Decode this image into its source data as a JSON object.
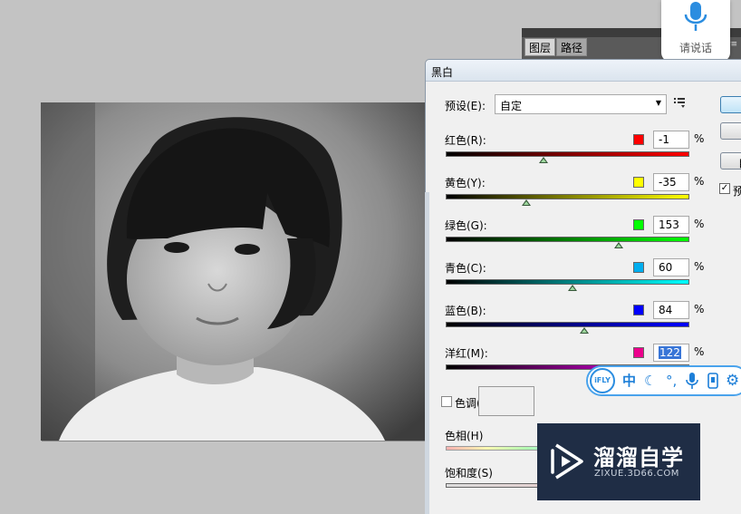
{
  "panel": {
    "tabs": [
      "图层",
      "路径"
    ]
  },
  "voice": {
    "label": "请说话"
  },
  "dialog": {
    "title": "黑白",
    "preset_label": "预设(E):",
    "preset_value": "自定",
    "auto_button_fragment": "自",
    "preview_fragment": "预",
    "preview_checked": true,
    "sliders": [
      {
        "label": "红色(R):",
        "value": "-1",
        "unit": "%",
        "swatch": "#ff0000",
        "gradient": [
          "#000000",
          "#ff0000"
        ],
        "position": 0.4
      },
      {
        "label": "黄色(Y):",
        "value": "-35",
        "unit": "%",
        "swatch": "#ffff00",
        "gradient": [
          "#000000",
          "#ffff00"
        ],
        "position": 0.33
      },
      {
        "label": "绿色(G):",
        "value": "153",
        "unit": "%",
        "swatch": "#00ff00",
        "gradient": [
          "#000000",
          "#00ff00"
        ],
        "position": 0.71
      },
      {
        "label": "青色(C):",
        "value": "60",
        "unit": "%",
        "swatch": "#00aeef",
        "gradient": [
          "#000000",
          "#00ffff"
        ],
        "position": 0.52
      },
      {
        "label": "蓝色(B):",
        "value": "84",
        "unit": "%",
        "swatch": "#0000ff",
        "gradient": [
          "#000000",
          "#0000ff"
        ],
        "position": 0.57
      },
      {
        "label": "洋红(M):",
        "value": "122",
        "unit": "%",
        "swatch": "#ec008c",
        "gradient": [
          "#000000",
          "#ff00ff"
        ],
        "position": 0.64
      }
    ],
    "tint_label": "色调(T)",
    "tint_checked": false,
    "hue_label": "色相(H)",
    "saturation_label": "饱和度(S)"
  },
  "watermark": {
    "title": "溜溜自学",
    "url": "ZIXUE.3D66.COM"
  },
  "ifly": {
    "logo": "iFLY",
    "icons": [
      "chinese-mode-icon",
      "moon-icon",
      "punctuation-icon",
      "microphone-icon",
      "keyboard-icon",
      "settings-icon"
    ],
    "chinese_glyph": "中"
  }
}
